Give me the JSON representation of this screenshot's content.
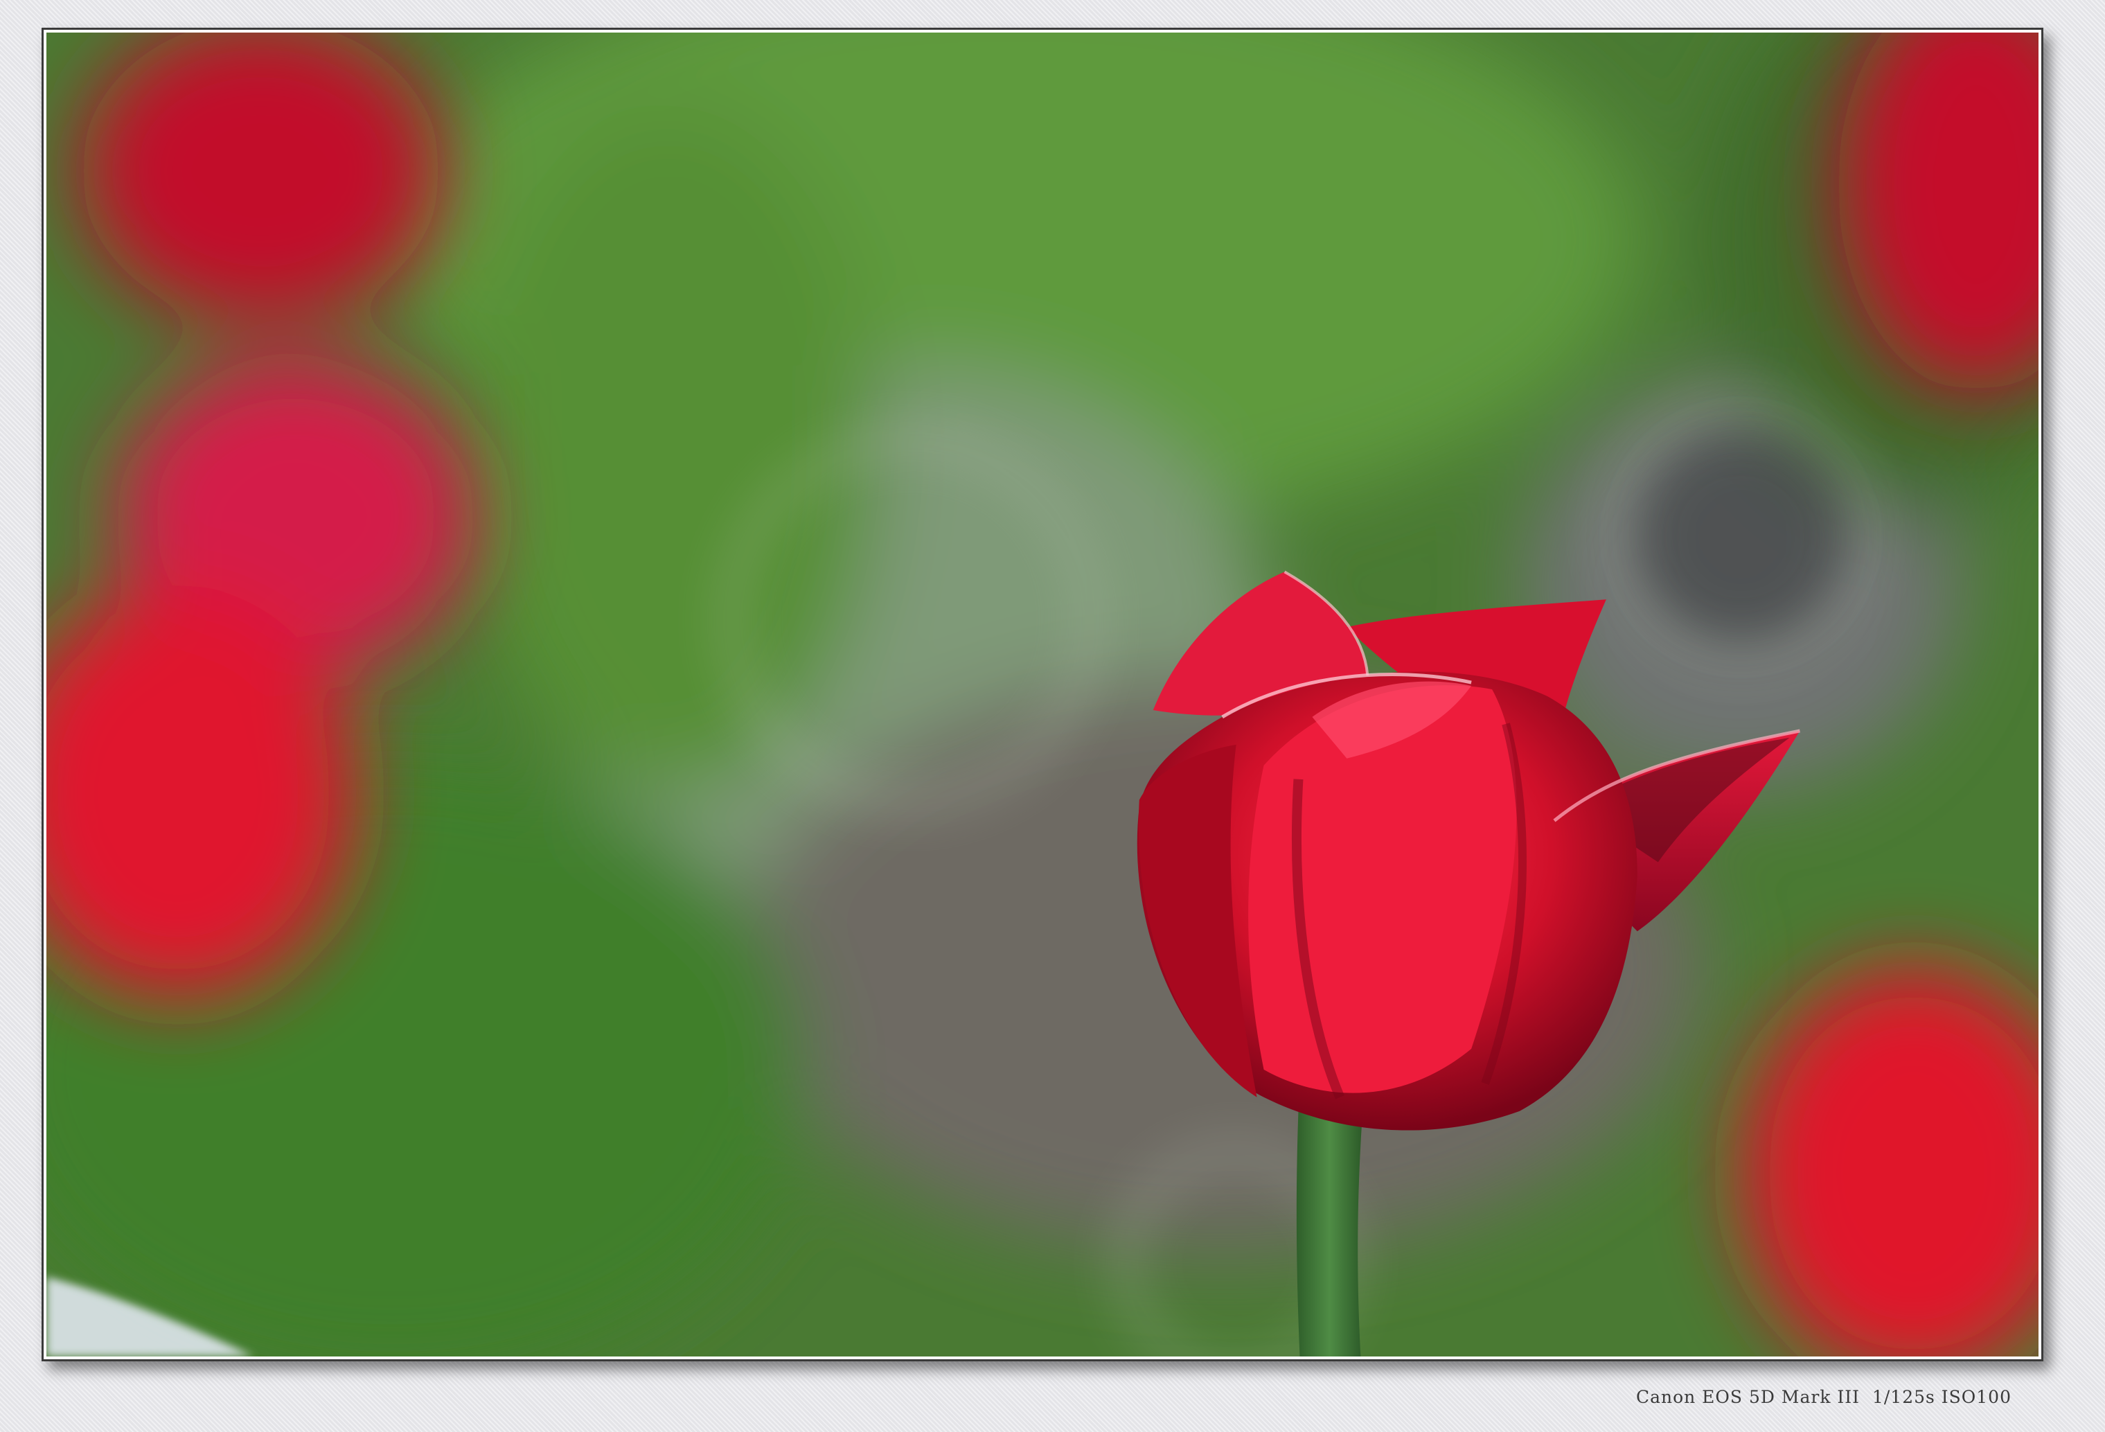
{
  "caption": {
    "exif": "Canon EOS 5D Mark III  1/125s ISO100"
  },
  "colors": {
    "background": "#e8e8ec",
    "frame_border": "#3a3a3a",
    "tulip_red": "#d0102a",
    "foliage_green": "#4c8a34",
    "stem_green": "#3f7a35"
  }
}
